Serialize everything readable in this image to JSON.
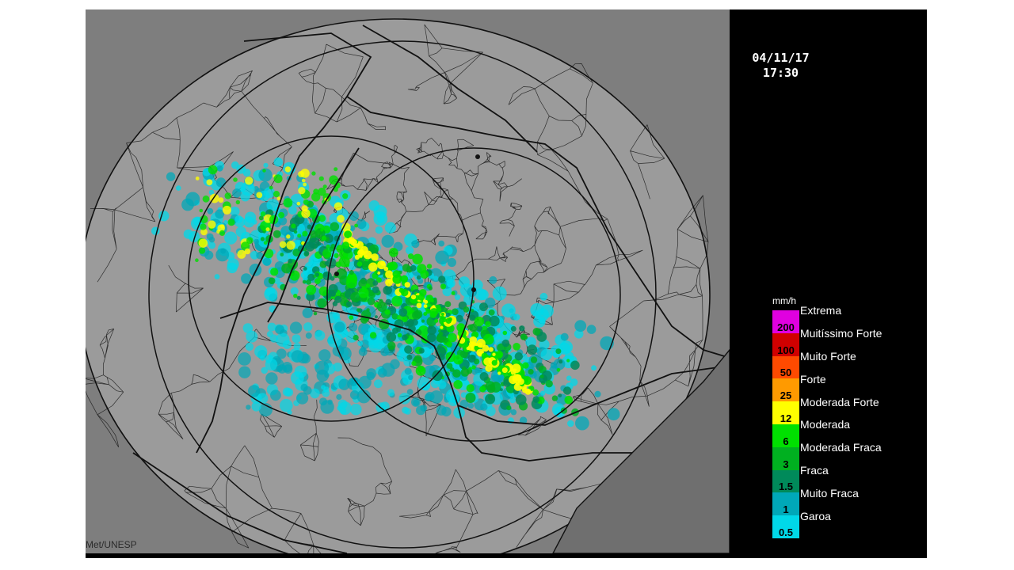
{
  "timestamp": {
    "date": "04/11/17",
    "time": "17:30"
  },
  "credit": "Met/UNESP",
  "legend": {
    "unit": "mm/h",
    "colors": [
      "#00d8e8",
      "#00a8b8",
      "#008a5a",
      "#00b020",
      "#00e000",
      "#ffff00",
      "#ff9a00",
      "#ff4a00",
      "#d00000",
      "#e000e0"
    ],
    "values": [
      "0.5",
      "1",
      "1.5",
      "3",
      "6",
      "12",
      "25",
      "50",
      "100",
      "200"
    ],
    "categories": [
      "Garoa",
      "Muito Fraca",
      "Fraca",
      "Moderada Fraca",
      "Moderada",
      "Moderada Forte",
      "Forte",
      "Muito Forte",
      "Muitíssimo Forte",
      "Extrema"
    ]
  },
  "map": {
    "background": "#7e7e7e",
    "coverage": "#9b9b9b",
    "lines": "#111111"
  }
}
